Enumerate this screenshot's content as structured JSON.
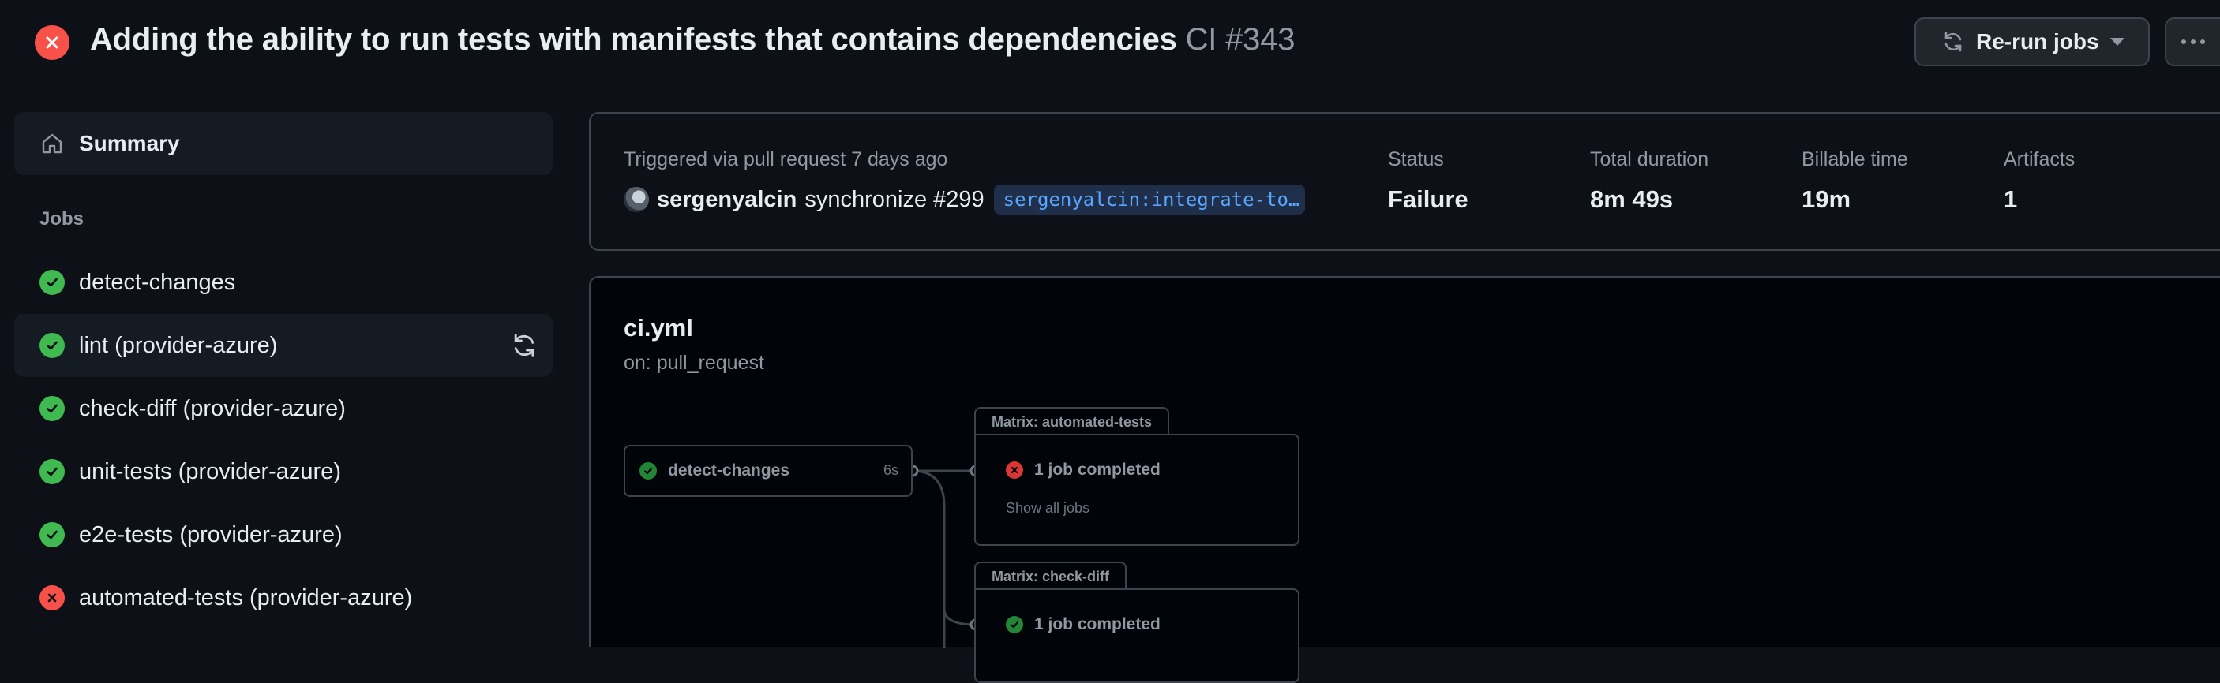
{
  "header": {
    "title": "Adding the ability to run tests with manifests that contains dependencies",
    "run_label": "CI #343",
    "rerun_label": "Re-run jobs",
    "status_icon": "x-circle-icon"
  },
  "sidebar": {
    "summary_label": "Summary",
    "jobs_heading": "Jobs",
    "jobs": [
      {
        "label": "detect-changes",
        "status": "success"
      },
      {
        "label": "lint (provider-azure)",
        "status": "success"
      },
      {
        "label": "check-diff (provider-azure)",
        "status": "success"
      },
      {
        "label": "unit-tests (provider-azure)",
        "status": "success"
      },
      {
        "label": "e2e-tests (provider-azure)",
        "status": "success"
      },
      {
        "label": "automated-tests (provider-azure)",
        "status": "failure"
      }
    ]
  },
  "run": {
    "trigger": "Triggered via pull request 7 days ago",
    "user": "sergenyalcin",
    "event": "synchronize #299",
    "branch": "sergenyalcin:integrate-to…",
    "stats": [
      {
        "label": "Status",
        "value": "Failure"
      },
      {
        "label": "Total duration",
        "value": "8m 49s"
      },
      {
        "label": "Billable time",
        "value": "19m"
      },
      {
        "label": "Artifacts",
        "value": "1"
      }
    ]
  },
  "workflow": {
    "file": "ci.yml",
    "trigger": "on: pull_request",
    "job_node": {
      "label": "detect-changes",
      "duration": "6s"
    },
    "matrices": [
      {
        "title": "Matrix: automated-tests",
        "summary": "1 job completed",
        "status": "failure",
        "show_all": "Show all jobs"
      },
      {
        "title": "Matrix: check-diff",
        "summary": "1 job completed",
        "status": "success"
      }
    ]
  },
  "colors": {
    "success": "#3fb950",
    "failure": "#f85149",
    "accent": "#58a6ff",
    "background": "#0d1117"
  }
}
